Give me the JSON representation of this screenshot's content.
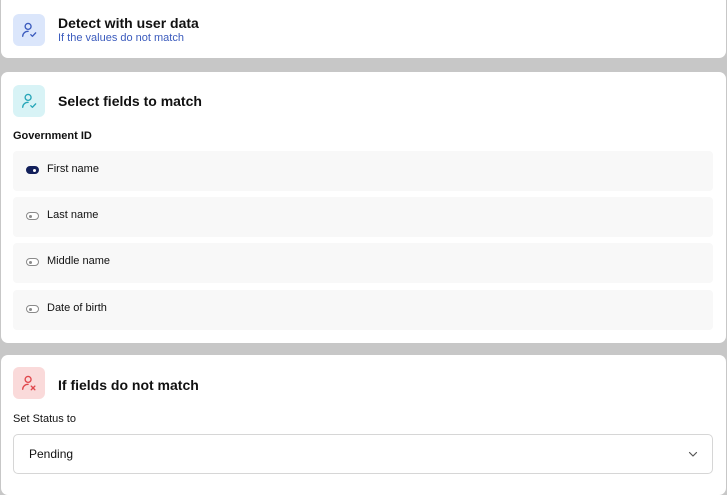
{
  "detect_card": {
    "title": "Detect with user data",
    "subtitle": "If the values do not match",
    "icon": "user-check-icon"
  },
  "match_card": {
    "title": "Select fields to match",
    "icon": "user-check-icon",
    "group_label": "Government ID",
    "fields": [
      {
        "label": "First name",
        "enabled": true
      },
      {
        "label": "Last name",
        "enabled": false
      },
      {
        "label": "Middle name",
        "enabled": false
      },
      {
        "label": "Date of birth",
        "enabled": false
      }
    ]
  },
  "mismatch_card": {
    "title": "If fields do not match",
    "icon": "user-x-icon",
    "status_label": "Set Status to",
    "status_value": "Pending"
  },
  "colors": {
    "blue_icon": "#3b5bbd",
    "teal_icon": "#27a6b8",
    "red_icon": "#e0474c",
    "toggle_on": "#13205b"
  }
}
